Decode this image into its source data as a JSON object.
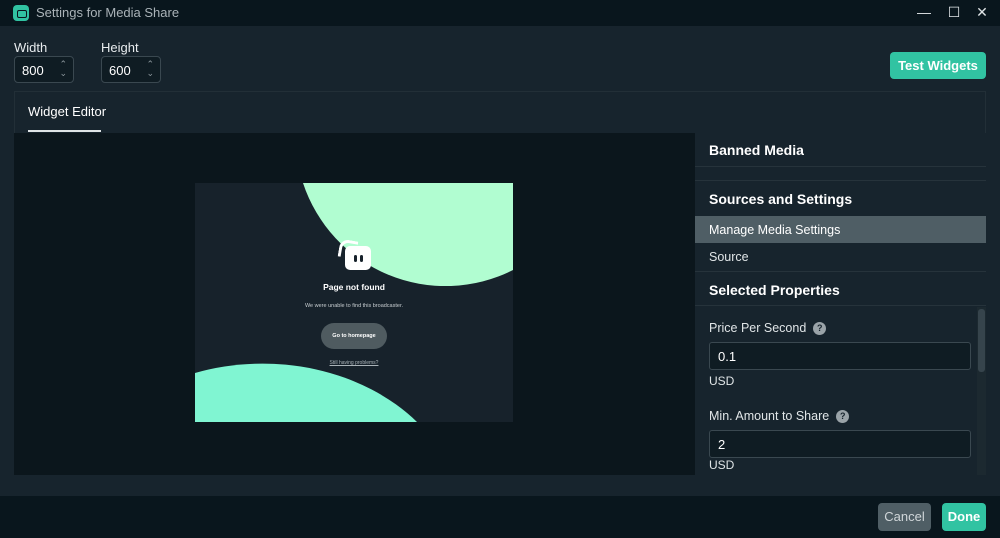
{
  "window": {
    "title": "Settings for Media Share",
    "minimize": "—",
    "maximize": "☐",
    "close": "✕"
  },
  "dimensions": {
    "width_label": "Width",
    "width_value": "800",
    "height_label": "Height",
    "height_value": "600"
  },
  "toolbar": {
    "test_widgets": "Test Widgets"
  },
  "tabs": [
    {
      "label": "Widget Editor",
      "active": true
    }
  ],
  "preview": {
    "heading": "Page not found",
    "message": "We were unable to find this broadcaster.",
    "button": "Go to homepage",
    "link": "Still having problems?"
  },
  "sidebar": {
    "banned_media": "Banned Media",
    "sources_heading": "Sources and Settings",
    "items": [
      {
        "label": "Manage Media Settings",
        "selected": true
      },
      {
        "label": "Source",
        "selected": false
      }
    ],
    "selected_heading": "Selected Properties",
    "fields": [
      {
        "label": "Price Per Second",
        "value": "0.1",
        "unit": "USD"
      },
      {
        "label": "Min. Amount to Share",
        "value": "2",
        "unit": "USD"
      }
    ]
  },
  "footer": {
    "cancel": "Cancel",
    "done": "Done"
  },
  "colors": {
    "accent": "#31c3a2",
    "selected": "#4f5e65"
  }
}
